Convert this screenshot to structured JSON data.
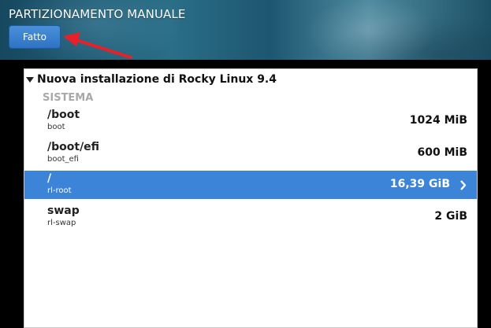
{
  "header": {
    "title": "PARTIZIONAMENTO MANUALE",
    "done_label": "Fatto"
  },
  "installation": {
    "title": "Nuova installazione di Rocky Linux 9.4"
  },
  "section": {
    "label": "SISTEMA"
  },
  "partitions": [
    {
      "mount": "/boot",
      "device": "boot",
      "size": "1024 MiB",
      "selected": false
    },
    {
      "mount": "/boot/efi",
      "device": "boot_efi",
      "size": "600 MiB",
      "selected": false
    },
    {
      "mount": "/",
      "device": "rl-root",
      "size": "16,39 GiB",
      "selected": true
    },
    {
      "mount": "swap",
      "device": "rl-swap",
      "size": "2 GiB",
      "selected": false
    }
  ],
  "colors": {
    "accent": "#3b84d8",
    "annotation_arrow": "#e8202a"
  },
  "icons": {
    "expander": "triangle-down-icon",
    "row_chevron": "chevron-right-icon",
    "annotation": "red-arrow-icon"
  }
}
